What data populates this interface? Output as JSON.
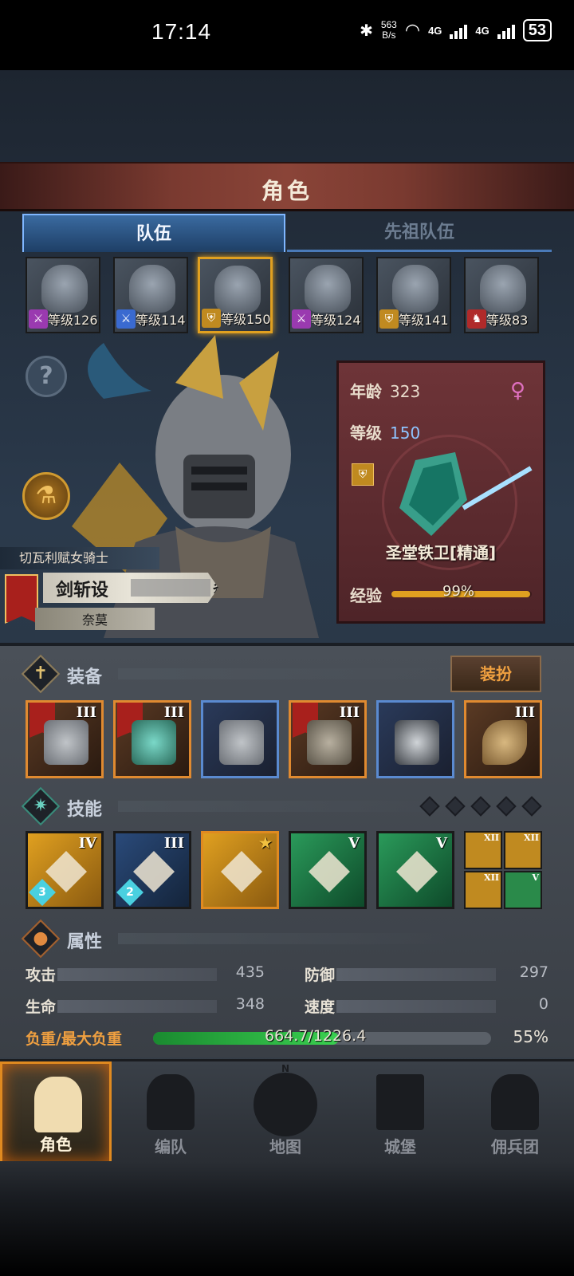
{
  "status_bar": {
    "time": "17:14",
    "net_speed_value": "563",
    "net_speed_unit": "B/s",
    "signal_1": "4G",
    "signal_2": "4G",
    "battery": "53"
  },
  "header": {
    "title": "角色"
  },
  "tabs": [
    {
      "label": "队伍",
      "active": true
    },
    {
      "label": "先祖队伍",
      "active": false
    }
  ],
  "roster": [
    {
      "level_label": "等级126",
      "class_color": "#9a3ab0",
      "selected": false
    },
    {
      "level_label": "等级114",
      "class_color": "#3a6ad0",
      "selected": false
    },
    {
      "level_label": "等级150",
      "class_color": "#c08a20",
      "selected": true
    },
    {
      "level_label": "等级124",
      "class_color": "#9a3ab0",
      "selected": false
    },
    {
      "level_label": "等级141",
      "class_color": "#c08a20",
      "selected": false
    },
    {
      "level_label": "等级83",
      "class_color": "#b02a2a",
      "selected": false
    }
  ],
  "character": {
    "title": "切瓦利赋女骑士",
    "name_visible": "剑斩设",
    "name_suffix": "炎",
    "home": "奈莫",
    "age_label": "年龄",
    "age": "323",
    "level_label": "等级",
    "level": "150",
    "gender_icon": "female-icon",
    "class_name": "圣堂铁卫[精通]",
    "exp_label": "经验",
    "exp_percent": "99%",
    "exp_fraction": 0.99
  },
  "equipment": {
    "label": "装备",
    "dress_button": "装扮",
    "slots": [
      {
        "tier": "III",
        "flag": true,
        "rarity": "orange",
        "icon": "shuriken-icon"
      },
      {
        "tier": "III",
        "flag": true,
        "rarity": "orange",
        "icon": "shield-icon"
      },
      {
        "tier": "",
        "flag": false,
        "rarity": "blue",
        "icon": "helmet-icon"
      },
      {
        "tier": "III",
        "flag": true,
        "rarity": "orange",
        "icon": "armor-icon"
      },
      {
        "tier": "",
        "flag": false,
        "rarity": "blue",
        "icon": "boots-icon"
      },
      {
        "tier": "III",
        "flag": false,
        "rarity": "orange",
        "icon": "horn-icon"
      }
    ]
  },
  "skills": {
    "label": "技能",
    "main": [
      {
        "tier": "IV",
        "level": "3",
        "color": "gold",
        "icon": "target-strike-icon"
      },
      {
        "tier": "III",
        "level": "2",
        "color": "navy",
        "icon": "shield-bash-icon"
      },
      {
        "tier": "",
        "level": "",
        "color": "gold",
        "icon": "guard-icon",
        "starred": true
      },
      {
        "tier": "V",
        "level": "",
        "color": "green",
        "icon": "crystal-burst-icon"
      },
      {
        "tier": "V",
        "level": "",
        "color": "green",
        "icon": "crystal-icon"
      }
    ],
    "passives": [
      {
        "tier": "XII",
        "color": "#c08a20",
        "icon": "shield-passive-icon"
      },
      {
        "tier": "XII",
        "color": "#c08a20",
        "icon": "bash-passive-icon"
      },
      {
        "tier": "XII",
        "color": "#c08a20",
        "icon": "strike-passive-icon"
      },
      {
        "tier": "V",
        "color": "#2a8a4a",
        "icon": "target-passive-icon"
      }
    ]
  },
  "attributes": {
    "label": "属性",
    "attack_label": "攻击",
    "attack": "435",
    "defense_label": "防御",
    "defense": "297",
    "hp_label": "生命",
    "hp": "348",
    "speed_label": "速度",
    "speed": "0",
    "load_label": "负重/最大负重",
    "load_text": "664.7/1226.4",
    "load_percent": "55%",
    "load_fraction": 0.55
  },
  "nav": [
    {
      "label": "角色",
      "active": true,
      "icon": "knight-icon"
    },
    {
      "label": "编队",
      "active": false,
      "icon": "formation-icon"
    },
    {
      "label": "地图",
      "active": false,
      "icon": "compass-map-icon"
    },
    {
      "label": "城堡",
      "active": false,
      "icon": "castle-icon"
    },
    {
      "label": "佣兵团",
      "active": false,
      "icon": "mercenary-icon"
    }
  ],
  "map_compass_letter": "N"
}
